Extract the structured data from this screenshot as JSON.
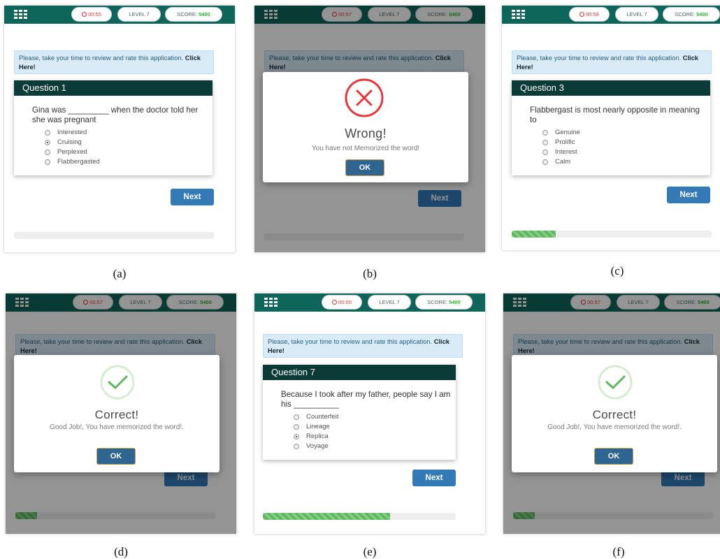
{
  "header": {
    "panel_a": {
      "time": "00:55",
      "level": "LEVEL 7",
      "score_label": "SCORE:",
      "score_value": "5400"
    },
    "panel_b": {
      "time": "00:57",
      "level": "LEVEL 7",
      "score_label": "SCORE:",
      "score_value": "5400"
    },
    "panel_c": {
      "time": "00:58",
      "level": "LEVEL 7",
      "score_label": "SCORE:",
      "score_value": "5400"
    },
    "panel_d": {
      "time": "00:57",
      "level": "LEVEL 7",
      "score_label": "SCORE:",
      "score_value": "5400"
    },
    "panel_e": {
      "time": "00:00",
      "level": "LEVEL 7",
      "score_label": "SCORE:",
      "score_value": "5400"
    },
    "panel_f": {
      "time": "00:57",
      "level": "LEVEL 7",
      "score_label": "SCORE:",
      "score_value": "5400"
    }
  },
  "banner": {
    "text": "Please, take your time to review and rate this application.",
    "link": "Click Here!"
  },
  "questions": {
    "a": {
      "title": "Question 1",
      "text": "Gina was _________ when the doctor told her she was pregnant",
      "options": [
        "Interested",
        "Cruising",
        "Perplexed",
        "Flabbergasted"
      ],
      "selected": 1
    },
    "c": {
      "title": "Question 3",
      "text": "Flabbergast is most nearly opposite in meaning to",
      "options": [
        "Genuine",
        "Prolific",
        "Interest",
        "Calm"
      ],
      "selected": -1
    },
    "e": {
      "title": "Question 7",
      "text": "Because I took after my father, people say I am his __________",
      "options": [
        "Counterfeit",
        "Lineage",
        "Replica",
        "Voyage"
      ],
      "selected": 2
    }
  },
  "buttons": {
    "next": "Next",
    "ok": "OK"
  },
  "dialogs": {
    "wrong": {
      "title": "Wrong!",
      "text": "You have not Memorized the word!"
    },
    "correct": {
      "title": "Correct!",
      "text": "Good Job!, You have memorized the word!."
    }
  },
  "progress": {
    "a": 0.0,
    "b": 0.0,
    "c": 0.22,
    "d": 0.11,
    "e": 0.66,
    "f": 0.11
  },
  "captions": {
    "a": "(a)",
    "b": "(b)",
    "c": "(c)",
    "d": "(d)",
    "e": "(e)",
    "f": "(f)"
  },
  "colors": {
    "header": "#0d6659",
    "question_header": "#0b3b36",
    "next_button": "#337ab7",
    "ok_button": "#2f6591",
    "wrong": "#e5363a",
    "correct": "#5cb85c",
    "score": "#2fb52f"
  },
  "icons": {
    "menu": "grid-icon",
    "timer": "alarm-clock-icon",
    "wrong": "x-circle-icon",
    "correct": "check-circle-icon"
  }
}
